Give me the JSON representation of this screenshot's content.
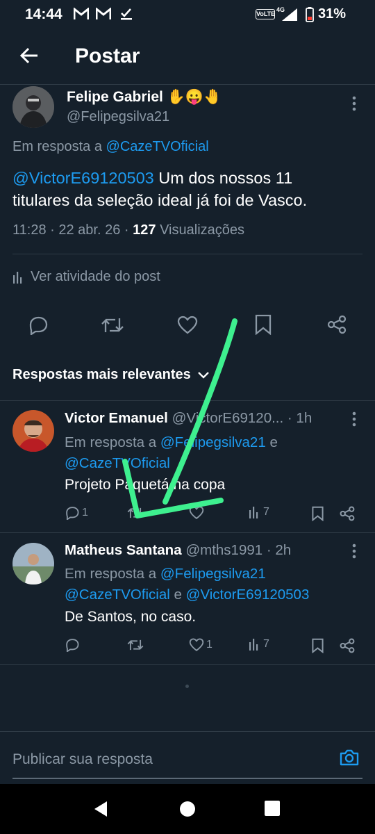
{
  "status_bar": {
    "time": "14:44",
    "network": "VoLTE",
    "signal": "4G",
    "battery": "31%"
  },
  "header": {
    "title": "Postar"
  },
  "main_post": {
    "author_name": "Felipe Gabriel",
    "author_emoji": "✋😛🤚",
    "author_handle": "@Felipegsilva21",
    "reply_prefix": "Em resposta a",
    "reply_to": "@CazeTVOficial",
    "mention": "@VictorE69120503",
    "text_line1": "Um dos nossos 11",
    "text_line2": "titulares da seleção ideal já foi de Vasco.",
    "time": "11:28",
    "separator": "·",
    "date": "22 abr. 26",
    "views_count": "127",
    "views_label": "Visualizações",
    "activity_label": "Ver atividade do post"
  },
  "replies_header": {
    "label": "Respostas mais relevantes"
  },
  "replies": [
    {
      "name": "Victor Emanuel",
      "handle": "@VictorE69120...",
      "age": "· 1h",
      "reply_prefix": "Em resposta a",
      "reply_to_1": "@Felipegsilva21",
      "connector": "e",
      "reply_to_2": "@CazeTVOficial",
      "text": "Projeto Paquetá na copa",
      "comments": "1",
      "retweets": "",
      "likes": "",
      "views": "7"
    },
    {
      "name": "Matheus Santana",
      "handle": "@mths1991",
      "age": "· 2h",
      "reply_prefix": "Em resposta a",
      "reply_to_1": "@Felipegsilva21",
      "reply_to_2": "@CazeTVOficial",
      "connector": "e",
      "reply_to_3": "@VictorE69120503",
      "text": "De Santos, no caso.",
      "comments": "",
      "retweets": "",
      "likes": "1",
      "views": "7"
    }
  ],
  "compose": {
    "placeholder": "Publicar sua resposta"
  },
  "colors": {
    "background": "#15202b",
    "link": "#1d9bf0",
    "annotation": "#3ef08f"
  }
}
